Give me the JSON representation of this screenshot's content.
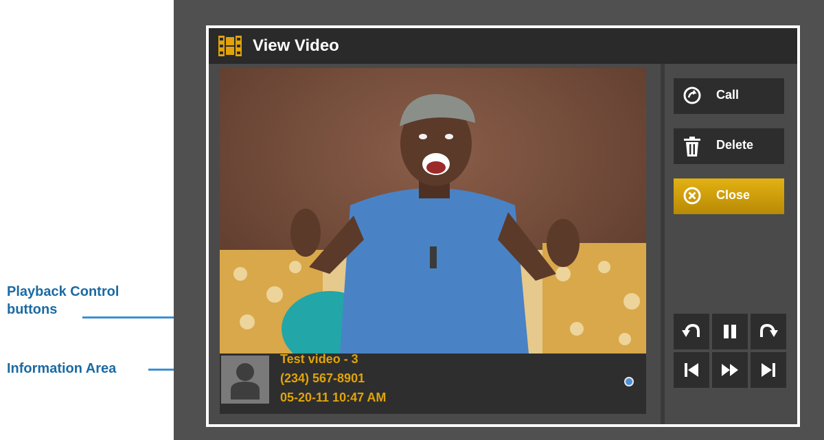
{
  "annotations": {
    "playback_label_line1": "Playback Control",
    "playback_label_line2": "buttons",
    "info_label": "Information Area"
  },
  "dialog": {
    "title": "View Video",
    "title_icon": "film-icon"
  },
  "info_area": {
    "name": "Test video - 3",
    "phone": "(234) 567-8901",
    "datetime": "05-20-11 10:47 AM"
  },
  "side_buttons": {
    "call": "Call",
    "delete": "Delete",
    "close": "Close"
  },
  "playback_controls": [
    {
      "icon": "skip-back-icon"
    },
    {
      "icon": "pause-icon"
    },
    {
      "icon": "skip-forward-icon"
    },
    {
      "icon": "previous-icon"
    },
    {
      "icon": "fast-forward-icon"
    },
    {
      "icon": "next-icon"
    }
  ],
  "colors": {
    "accent": "#e0a40a",
    "annotation": "#1a6aa3",
    "arrow": "#3b8fd6"
  }
}
